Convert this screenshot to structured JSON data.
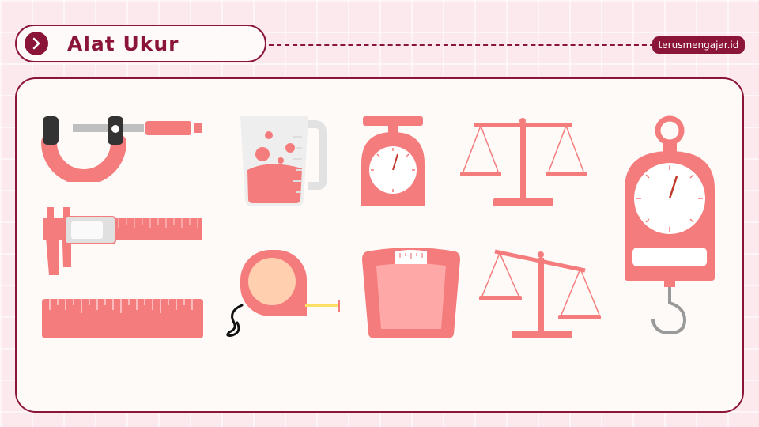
{
  "header": {
    "title": "Alat Ukur",
    "brand": "terusmengajar.id"
  },
  "icons": {
    "arrow": "chevron-right-icon",
    "tools": [
      "micrometer",
      "caliper",
      "ruler",
      "measuring-cup",
      "tape-measure",
      "kitchen-scale",
      "bathroom-scale",
      "balance-scale",
      "balance-scale-tilted",
      "hanging-scale"
    ]
  },
  "colors": {
    "accent": "#8a1538",
    "tool": "#f47c7c",
    "tool_light": "#ffa8a8",
    "background": "#fbe9ee"
  }
}
